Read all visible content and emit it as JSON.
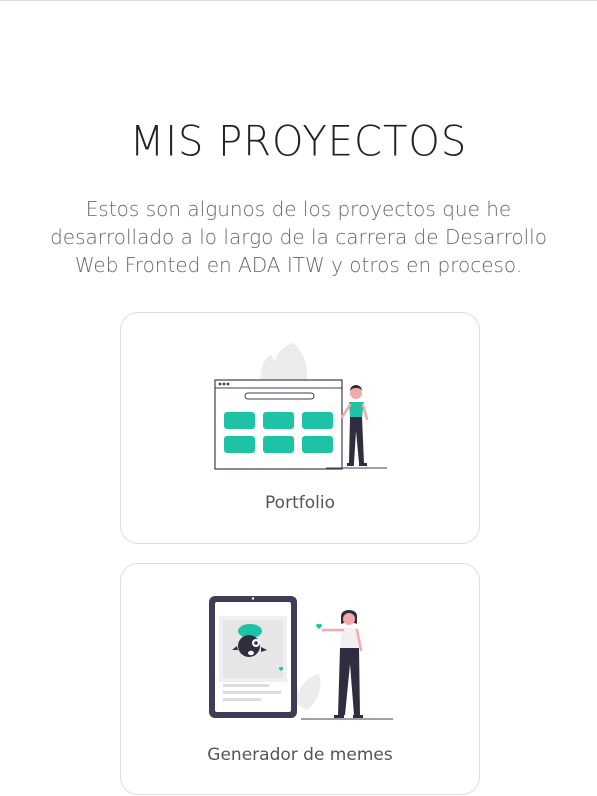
{
  "section": {
    "title": "MIS PROYECTOS",
    "description": "Estos son algunos de los proyectos que he desarrollado a lo largo de la carrera de Desarrollo Web Fronted en ADA ITW y otros en proceso."
  },
  "projects": [
    {
      "label": "Portfolio",
      "illustration": "website-builder-illustration"
    },
    {
      "label": "Generador de memes",
      "illustration": "tablet-meme-illustration"
    }
  ],
  "colors": {
    "accent": "#1ec3a5",
    "dark": "#2f2e41",
    "skin": "#f5a9a9",
    "leaf": "#ececec",
    "text_title": "#222222",
    "text_body": "#666666"
  }
}
